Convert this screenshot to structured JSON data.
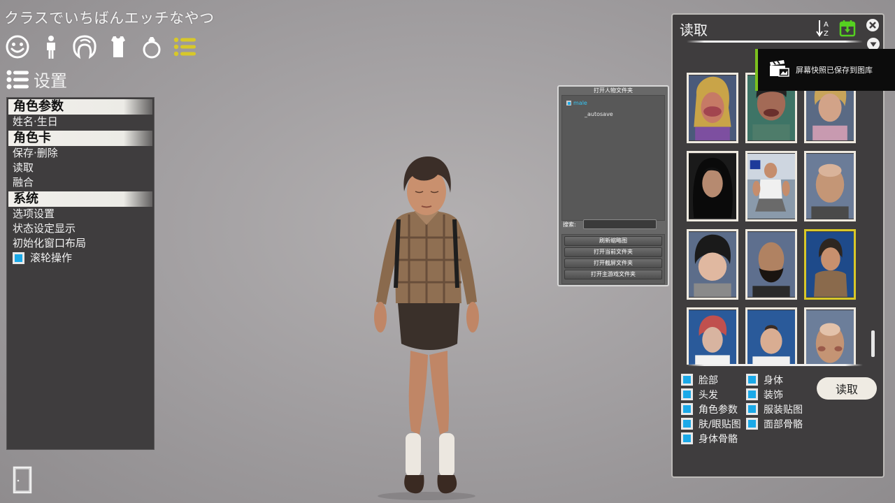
{
  "game": {
    "title": "クラスでいちばんエッチなやつ"
  },
  "category_bar": {
    "icons": [
      "face-icon",
      "body-icon",
      "hair-icon",
      "clothing-icon",
      "accessory-icon",
      "settings-list-icon"
    ],
    "active": "settings-list-icon"
  },
  "settings": {
    "title": "设置"
  },
  "left_menu": {
    "section1": {
      "header": "角色参数",
      "items": [
        "姓名·生日"
      ]
    },
    "section2": {
      "header": "角色卡",
      "items": [
        "保存·删除",
        "读取",
        "融合"
      ]
    },
    "section3": {
      "header": "系统",
      "items": [
        "选项设置",
        "状态设定显示",
        "初始化窗口布局"
      ]
    },
    "wheel_toggle": {
      "label": "滚轮操作",
      "checked": true
    }
  },
  "folder_panel": {
    "title": "打开人物文件夹",
    "tree": {
      "root": "male",
      "child": "_autosave"
    },
    "search_label": "搜索:",
    "search_value": "",
    "buttons": [
      "刷新缩略图",
      "打开当前文件夹",
      "打开截屏文件夹",
      "打开主游戏文件夹"
    ]
  },
  "load_panel": {
    "title": "读取",
    "sort_icon": "sort-az-icon",
    "calendar_icon": "calendar-down-icon",
    "close_icon": "close-icon",
    "selected_thumbnail": 9,
    "options_left": [
      "脸部",
      "头发",
      "角色参数",
      "肤/眼贴图",
      "身体骨骼"
    ],
    "options_right": [
      "身体",
      "装饰",
      "服装贴图",
      "面部骨骼"
    ],
    "load_button": "读取"
  },
  "notification": {
    "text": "屏幕快照已保存到图库",
    "icon": "clapperboard-icon"
  },
  "colors": {
    "accent": "#1ba9e8",
    "selected": "#d8c829",
    "panel": "#3f3d3e",
    "notify": "#7bc01e"
  }
}
